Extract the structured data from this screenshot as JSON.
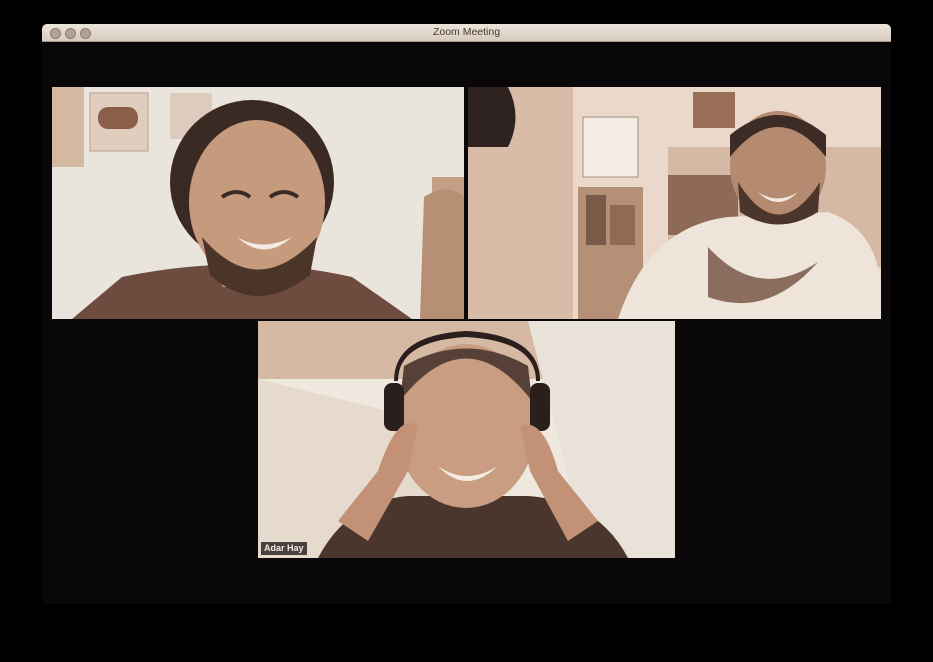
{
  "window": {
    "title": "Zoom Meeting"
  },
  "participants": [
    {
      "name": ""
    },
    {
      "name": ""
    },
    {
      "name": "Adar Hay"
    }
  ],
  "colors": {
    "background": "#0a0708",
    "video_tint": "#c9ac97",
    "titlebar": "#e3d8cd"
  }
}
